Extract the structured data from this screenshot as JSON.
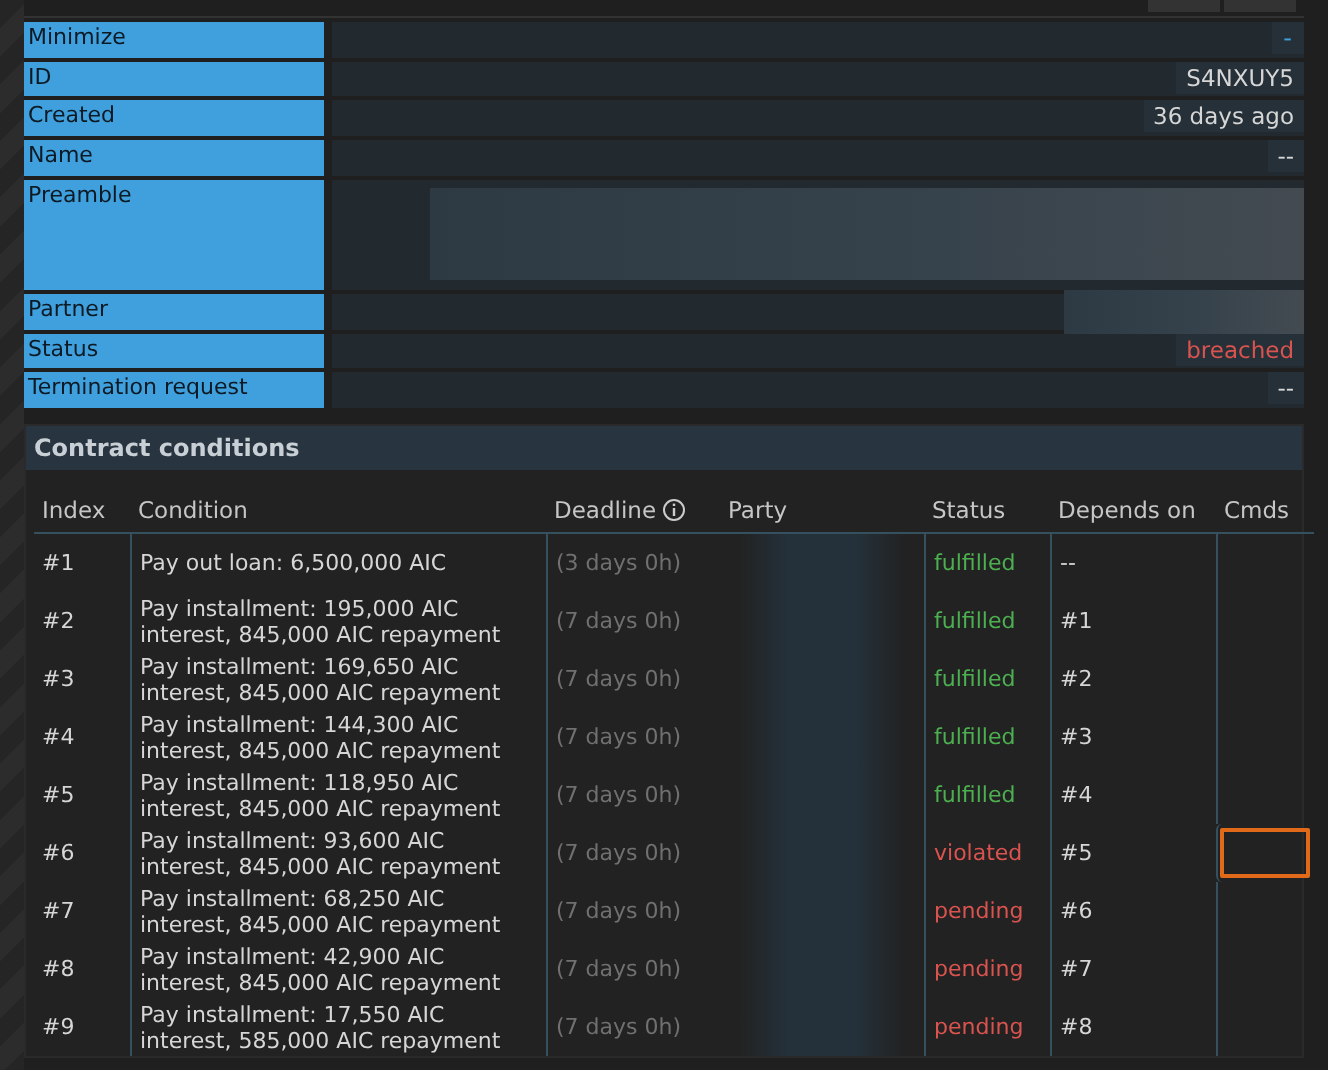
{
  "fields": [
    {
      "label": "Minimize",
      "value": "-",
      "kind": "button"
    },
    {
      "label": "ID",
      "value": "S4NXUY5",
      "kind": "text"
    },
    {
      "label": "Created",
      "value": "36 days ago",
      "kind": "text"
    },
    {
      "label": "Name",
      "value": "--",
      "kind": "text"
    },
    {
      "label": "Preamble",
      "kind": "redacted-tall"
    },
    {
      "label": "Partner",
      "kind": "redacted"
    },
    {
      "label": "Status",
      "value": "breached",
      "kind": "alert"
    },
    {
      "label": "Termination request",
      "value": "--",
      "kind": "text"
    }
  ],
  "conditions": {
    "title": "Contract conditions",
    "columns": [
      "Index",
      "Condition",
      "Deadline",
      "Party",
      "Status",
      "Depends on",
      "Cmds"
    ],
    "rows": [
      {
        "index": "#1",
        "condition": "Pay out loan: 6,500,000 AIC",
        "deadline": "(3 days 0h)",
        "status": "fulfilled",
        "color": "#4caf50",
        "depends": "--",
        "focused": false
      },
      {
        "index": "#2",
        "condition": "Pay installment: 195,000 AIC interest, 845,000 AIC repayment",
        "deadline": "(7 days 0h)",
        "status": "fulfilled",
        "color": "#4caf50",
        "depends": "#1",
        "focused": false
      },
      {
        "index": "#3",
        "condition": "Pay installment: 169,650 AIC interest, 845,000 AIC repayment",
        "deadline": "(7 days 0h)",
        "status": "fulfilled",
        "color": "#4caf50",
        "depends": "#2",
        "focused": false
      },
      {
        "index": "#4",
        "condition": "Pay installment: 144,300 AIC interest, 845,000 AIC repayment",
        "deadline": "(7 days 0h)",
        "status": "fulfilled",
        "color": "#4caf50",
        "depends": "#3",
        "focused": false
      },
      {
        "index": "#5",
        "condition": "Pay installment: 118,950 AIC interest, 845,000 AIC repayment",
        "deadline": "(7 days 0h)",
        "status": "fulfilled",
        "color": "#4caf50",
        "depends": "#4",
        "focused": false
      },
      {
        "index": "#6",
        "condition": "Pay installment: 93,600 AIC interest, 845,000 AIC repayment",
        "deadline": "(7 days 0h)",
        "status": "violated",
        "color": "#d9534f",
        "depends": "#5",
        "focused": true
      },
      {
        "index": "#7",
        "condition": "Pay installment: 68,250 AIC interest, 845,000 AIC repayment",
        "deadline": "(7 days 0h)",
        "status": "pending",
        "color": "#d9534f",
        "depends": "#6",
        "focused": false
      },
      {
        "index": "#8",
        "condition": "Pay installment: 42,900 AIC interest, 845,000 AIC repayment",
        "deadline": "(7 days 0h)",
        "status": "pending",
        "color": "#d9534f",
        "depends": "#7",
        "focused": false
      },
      {
        "index": "#9",
        "condition": "Pay installment: 17,550 AIC interest, 585,000 AIC repayment",
        "deadline": "(7 days 0h)",
        "status": "pending",
        "color": "#d9534f",
        "depends": "#8",
        "focused": false
      }
    ]
  }
}
